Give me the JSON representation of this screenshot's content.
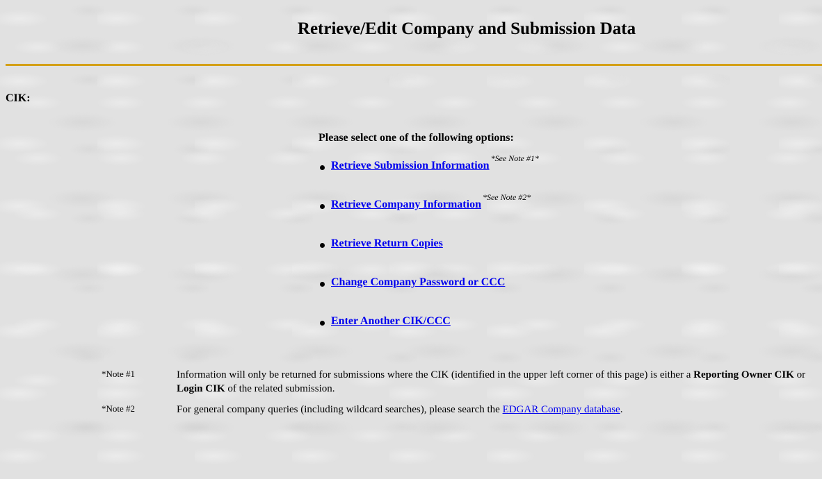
{
  "page": {
    "title": "Retrieve/Edit Company and Submission Data",
    "cik_label": "CIK:"
  },
  "options": {
    "heading": "Please select one of the following options:",
    "items": [
      {
        "label": "Retrieve Submission Information",
        "note": "*See Note #1*"
      },
      {
        "label": "Retrieve Company Information",
        "note": "*See Note #2*"
      },
      {
        "label": "Retrieve Return Copies",
        "note": ""
      },
      {
        "label": "Change Company Password or CCC",
        "note": ""
      },
      {
        "label": "Enter Another CIK/CCC",
        "note": ""
      }
    ]
  },
  "notes": {
    "note1": {
      "label": "*Note #1",
      "text_before": "Information will only be returned for submissions where the CIK (identified in the upper left corner of this page) is either a ",
      "bold1": "Reporting Owner CIK",
      "text_mid": " or ",
      "bold2": "Login CIK",
      "text_after": " of the related submission."
    },
    "note2": {
      "label": "*Note #2",
      "text_before": "For general company queries (including wildcard searches), please search the ",
      "link": "EDGAR Company database",
      "text_after": "."
    }
  },
  "colors": {
    "rule": "#d4a017",
    "link": "#0000ee",
    "background": "#e1e1e1"
  }
}
